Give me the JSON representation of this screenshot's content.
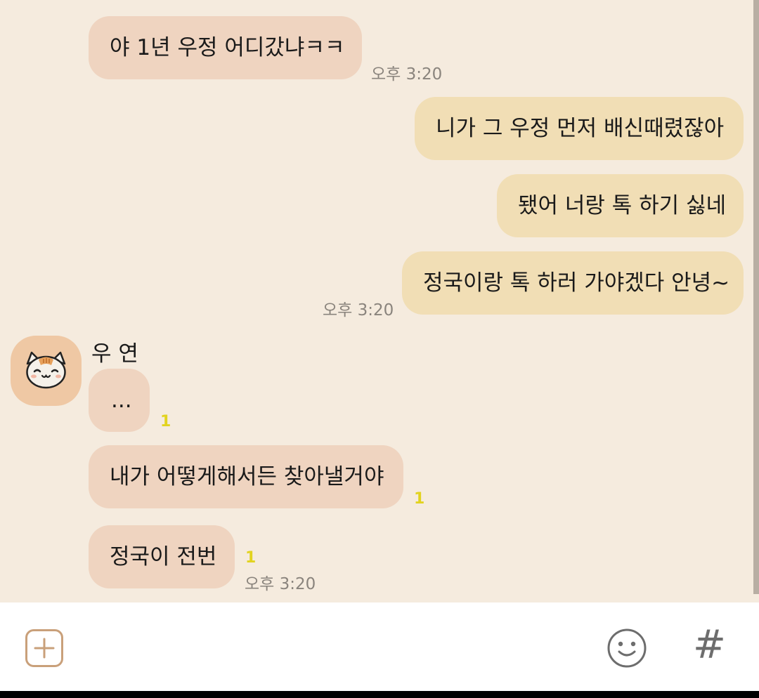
{
  "messages": [
    {
      "text": "야 1년 우정 어디갔냐ㅋㅋ",
      "time": "오후 3:20"
    },
    {
      "text": "니가 그 우정 먼저 배신때렸잖아"
    },
    {
      "text": "됐어 너랑 톡 하기 싫네"
    },
    {
      "text": "정국이랑 톡 하러 가야겠다 안녕~",
      "time": "오후 3:20"
    },
    {
      "text": "...",
      "unread": "1"
    },
    {
      "text": "내가 어떻게해서든 찾아낼거야",
      "unread": "1"
    },
    {
      "text": "정국이 전번",
      "unread": "1",
      "time": "오후 3:20"
    }
  ],
  "sender": {
    "name": "우 연",
    "avatar_icon": "cat-face-icon"
  },
  "input_bar": {
    "plus_icon": "plus-square-icon",
    "emoji_icon": "smiley-icon",
    "hash_icon": "hash-icon",
    "hash_symbol": "#"
  },
  "colors": {
    "chat_background": "#f5ebde",
    "incoming_bubble": "#efd4c0",
    "outgoing_bubble": "#f1deb5",
    "unread_count": "#e2d31f",
    "timestamp": "#8a847d",
    "accent": "#c9a07a"
  }
}
